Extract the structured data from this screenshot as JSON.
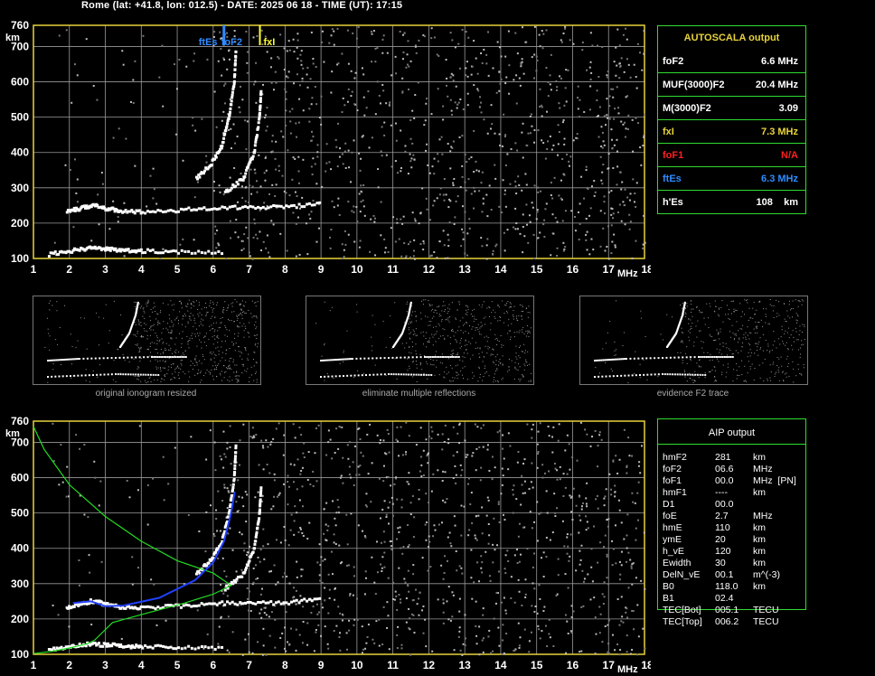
{
  "header": "Rome (lat: +41.8, lon: 012.5) - DATE: 2025 06 18 - TIME (UT): 17:15",
  "axis": {
    "y_unit": "km",
    "x_unit": "MHz",
    "y_ticks": [
      "760",
      "700",
      "600",
      "500",
      "400",
      "300",
      "200",
      "100"
    ],
    "x_ticks": [
      "1",
      "2",
      "3",
      "4",
      "5",
      "6",
      "7",
      "8",
      "9",
      "10",
      "11",
      "12",
      "13",
      "14",
      "15",
      "16",
      "17",
      "18"
    ]
  },
  "markers": {
    "ftEs": "ftEs",
    "foF2": "foF2",
    "fxI": "fxI"
  },
  "autoscala": {
    "title": "AUTOSCALA output",
    "rows": [
      {
        "label": "foF2",
        "value": "6.6 MHz",
        "color": "#ffffff"
      },
      {
        "label": "MUF(3000)F2",
        "value": "20.4 MHz",
        "color": "#ffffff"
      },
      {
        "label": "M(3000)F2",
        "value": "3.09",
        "color": "#ffffff"
      },
      {
        "label": "fxI",
        "value": "7.3 MHz",
        "color": "#e8d23a"
      },
      {
        "label": "foF1",
        "value": "N/A",
        "color": "#ff2020"
      },
      {
        "label": "ftEs",
        "value": "6.3 MHz",
        "color": "#2f8bff"
      },
      {
        "label": "h'Es",
        "value": "108    km",
        "color": "#ffffff"
      }
    ]
  },
  "aip": {
    "title": "AIP output",
    "rows": [
      {
        "k": "hmF2",
        "v": "281",
        "u": "km"
      },
      {
        "k": "foF2",
        "v": "06.6",
        "u": "MHz"
      },
      {
        "k": "foF1",
        "v": "00.0",
        "u": "MHz  [PN]"
      },
      {
        "k": "hmF1",
        "v": "----",
        "u": "km"
      },
      {
        "k": "D1",
        "v": "00.0",
        "u": ""
      },
      {
        "k": "foE",
        "v": "2.7",
        "u": "MHz"
      },
      {
        "k": "hmE",
        "v": "110",
        "u": "km"
      },
      {
        "k": "ymE",
        "v": "20",
        "u": "km"
      },
      {
        "k": "h_vE",
        "v": "120",
        "u": "km"
      },
      {
        "k": "Ewidth",
        "v": "30",
        "u": "km"
      },
      {
        "k": "DelN_vE",
        "v": "00.1",
        "u": "m^(-3)"
      },
      {
        "k": "B0",
        "v": "118.0",
        "u": "km"
      },
      {
        "k": "B1",
        "v": "02.4",
        "u": ""
      },
      {
        "k": "TEC[Bot]",
        "v": "005.1",
        "u": "TECU"
      },
      {
        "k": "TEC[Top]",
        "v": "006.2",
        "u": "TECU"
      }
    ]
  },
  "thumbs": [
    {
      "caption": "original ionogram resized"
    },
    {
      "caption": "eliminate multiple reflections"
    },
    {
      "caption": "evidence F2 trace"
    }
  ],
  "colors": {
    "grid": "#9a9a9a",
    "frame": "#e8d23a",
    "table": "#2fdc2f",
    "es": "#2f8bff",
    "fxi": "#ffff30",
    "profile": "#22dd22",
    "fit": "#2040ff"
  },
  "chart_data": [
    {
      "type": "scatter",
      "title": "",
      "xlabel": "MHz",
      "ylabel": "km",
      "xlim": [
        1,
        18
      ],
      "ylim": [
        100,
        760
      ],
      "grid": true,
      "series": [
        {
          "x": [
            1.4,
            2,
            2.5,
            3,
            3.5,
            4,
            5,
            6.3
          ],
          "y": [
            115,
            125,
            132,
            130,
            127,
            125,
            123,
            122
          ]
        },
        {
          "x": [
            1.9,
            2.3,
            2.6,
            3.0,
            3.4,
            4.0,
            5.0,
            6.0,
            7.0,
            8.0,
            9.0
          ],
          "y": [
            238,
            246,
            255,
            245,
            238,
            236,
            240,
            248,
            248,
            250,
            260
          ]
        },
        {
          "x": [
            5.5,
            5.9,
            6.2,
            6.4,
            6.55,
            6.6
          ],
          "y": [
            330,
            370,
            420,
            500,
            600,
            700
          ]
        },
        {
          "x": [
            6.3,
            6.8,
            7.1,
            7.25,
            7.3
          ],
          "y": [
            290,
            330,
            400,
            500,
            580
          ]
        }
      ]
    },
    {
      "type": "line",
      "title": "",
      "xlabel": "MHz",
      "ylabel": "km",
      "xlim": [
        1,
        18
      ],
      "ylim": [
        100,
        760
      ],
      "grid": true,
      "series": [
        {
          "x": [
            1.0,
            1.5,
            2.0,
            2.5,
            2.7,
            3.2,
            4.2,
            5.2,
            6.0,
            6.5,
            6.0,
            5.0,
            4.0,
            3.0,
            2.0,
            1.3,
            1.0
          ],
          "y": [
            102,
            108,
            118,
            130,
            140,
            190,
            218,
            245,
            270,
            295,
            330,
            365,
            420,
            490,
            580,
            680,
            745
          ]
        },
        {
          "x": [
            2.1,
            2.6,
            3.0,
            3.5,
            4.5,
            5.5,
            6.0,
            6.3,
            6.5,
            6.6
          ],
          "y": [
            245,
            250,
            236,
            238,
            260,
            310,
            360,
            420,
            500,
            560
          ]
        }
      ]
    }
  ]
}
